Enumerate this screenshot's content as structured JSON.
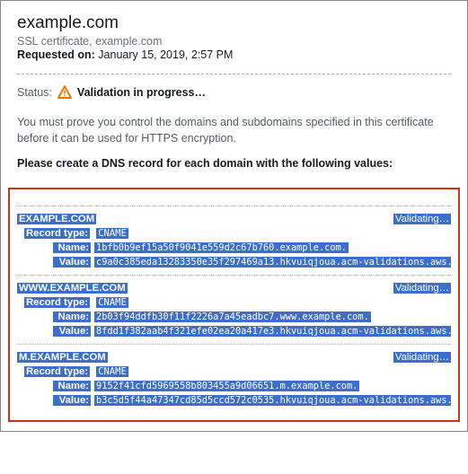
{
  "header": {
    "title": "example.com",
    "subtitle": "SSL certificate, example.com",
    "requested_label": "Requested on:",
    "requested_value": "January 15, 2019, 2:57 PM"
  },
  "status": {
    "label": "Status:",
    "text": "Validation in progress…",
    "icon": "warning-triangle-icon"
  },
  "help_text": "You must prove you control the domains and subdomains specified in this certificate before it can be used for HTTPS encryption.",
  "instruction": "Please create a DNS record for each domain with the following values:",
  "record_labels": {
    "record_type": "Record type:",
    "name": "Name:",
    "value": "Value:",
    "validating": "Validating…"
  },
  "records": [
    {
      "domain": "EXAMPLE.COM",
      "type": "CNAME",
      "name": "1bfb0b9ef15a50f9041e559d2c67b760.example.com.",
      "value": "c9a0c385eda13283350e35f297469a13.hkvuiqjoua.acm-validations.aws."
    },
    {
      "domain": "WWW.EXAMPLE.COM",
      "type": "CNAME",
      "name": "2b03f94ddfb30f11f2226a7a45eadbc7.www.example.com.",
      "value": "8fdd1f382aab4f321efe02ea20a417e3.hkvuiqjoua.acm-validations.aws."
    },
    {
      "domain": "M.EXAMPLE.COM",
      "type": "CNAME",
      "name": "9152f41cfd5969558b803455a9d06651.m.example.com.",
      "value": "b3c5d5f44a47347cd85d5ccd572c0535.hkvuiqjoua.acm-validations.aws."
    }
  ]
}
